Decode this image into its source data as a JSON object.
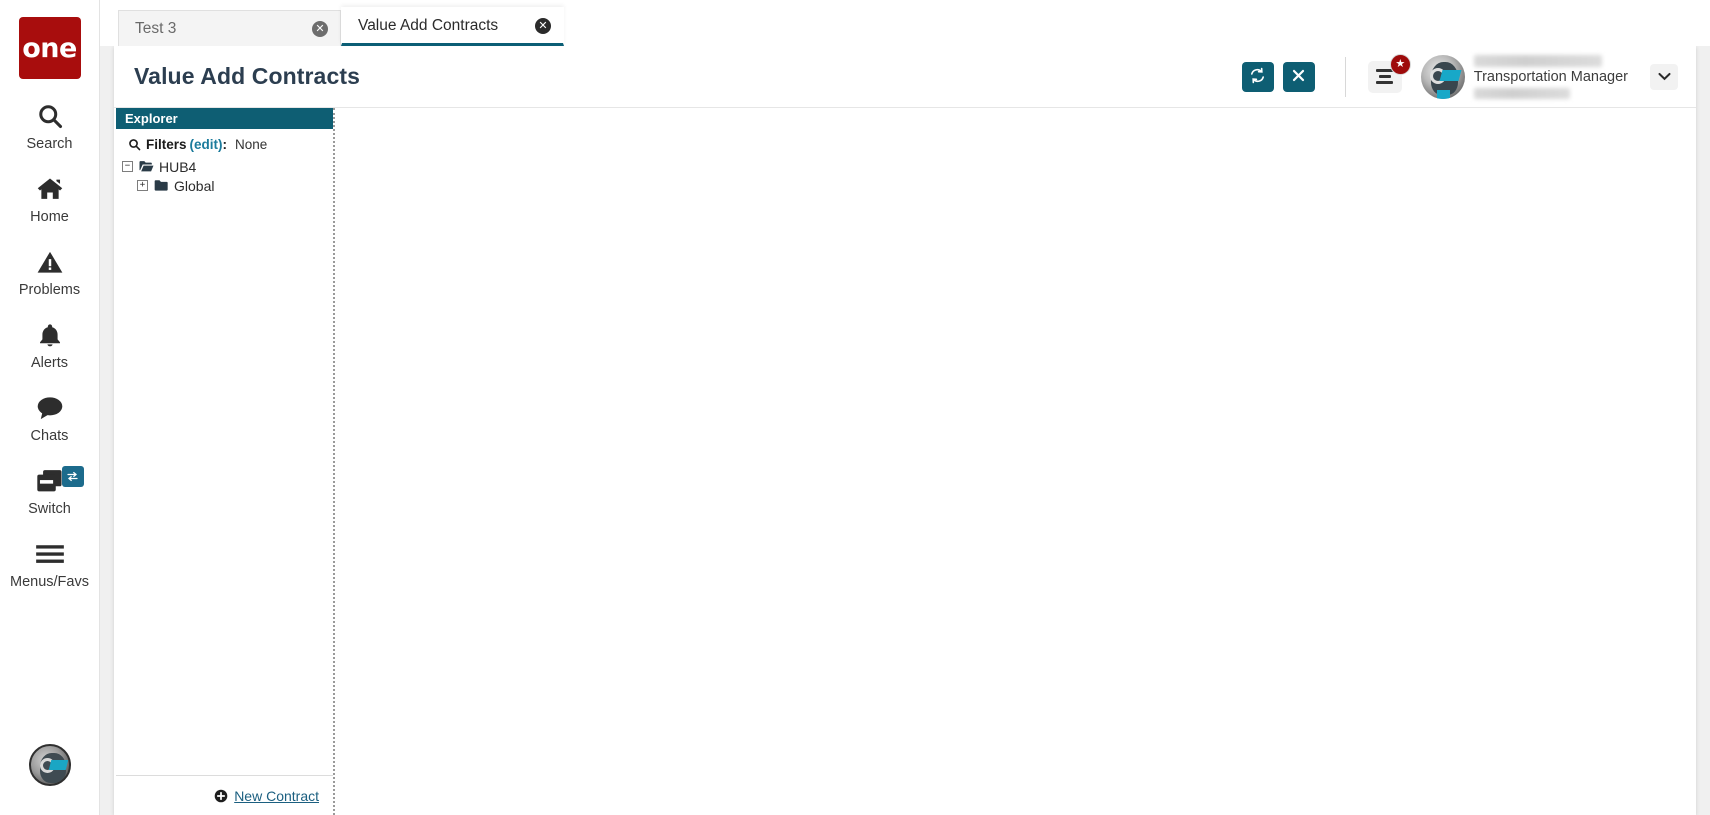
{
  "brand": {
    "logo_text": "one"
  },
  "rail": {
    "items": [
      {
        "label": "Search",
        "icon": "search-icon"
      },
      {
        "label": "Home",
        "icon": "home-icon"
      },
      {
        "label": "Problems",
        "icon": "warning-triangle-icon"
      },
      {
        "label": "Alerts",
        "icon": "bell-icon"
      },
      {
        "label": "Chats",
        "icon": "chat-bubble-icon"
      },
      {
        "label": "Switch",
        "icon": "windows-stack-icon",
        "badge_icon": "swap-arrows-icon"
      },
      {
        "label": "Menus/Favs",
        "icon": "hamburger-icon"
      }
    ],
    "avatar_icon": "user-avatar-icon"
  },
  "tabs": [
    {
      "label": "Test 3",
      "active": false,
      "close_icon": "close-circle-icon"
    },
    {
      "label": "Value Add Contracts",
      "active": true,
      "close_icon": "close-circle-icon"
    }
  ],
  "header": {
    "title": "Value Add Contracts",
    "refresh_icon": "refresh-icon",
    "close_icon": "x-icon",
    "menu_favs_icon": "menu-list-icon",
    "favorite_badge_icon": "star-icon",
    "caret_icon": "chevron-down-icon",
    "user": {
      "name": "",
      "role": "Transportation Manager",
      "id": ""
    }
  },
  "explorer": {
    "title": "Explorer",
    "filters": {
      "search_icon": "search-icon",
      "label": "Filters",
      "edit_label": "(edit)",
      "colon": ":",
      "value": "None"
    },
    "tree": [
      {
        "label": "HUB4",
        "level": 0,
        "toggle": "−",
        "icon": "folder-open-icon"
      },
      {
        "label": "Global",
        "level": 1,
        "toggle": "+",
        "icon": "folder-closed-icon"
      }
    ],
    "footer": {
      "new_contract_label": "New Contract",
      "plus_icon": "plus-circle-icon"
    }
  },
  "colors": {
    "brand_red": "#a80d0d",
    "accent_teal": "#0e5e73",
    "link_blue": "#1b7b9c",
    "badge_red": "#9e0b0b"
  }
}
